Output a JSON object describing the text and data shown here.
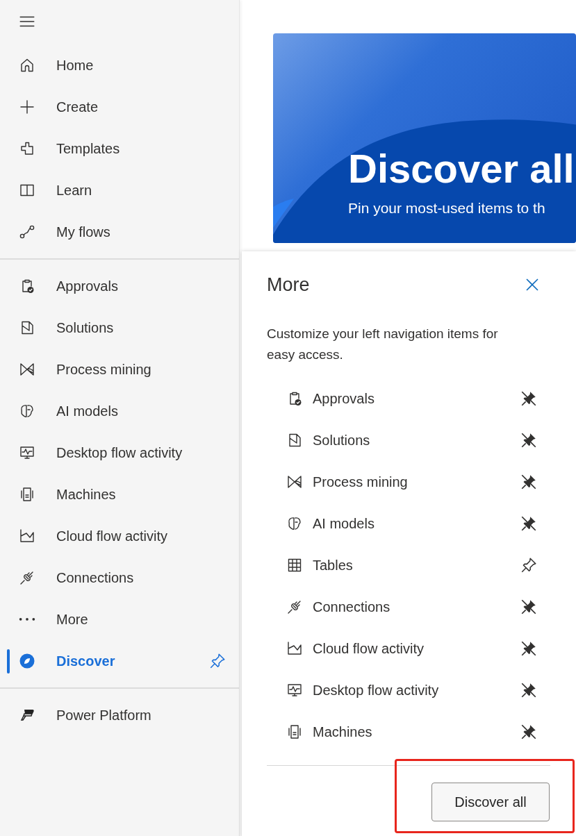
{
  "sidebar": {
    "sections": [
      {
        "items": [
          {
            "label": "Home",
            "selected": false
          },
          {
            "label": "Create",
            "selected": false
          },
          {
            "label": "Templates",
            "selected": false
          },
          {
            "label": "Learn",
            "selected": false
          },
          {
            "label": "My flows",
            "selected": false
          }
        ]
      },
      {
        "items": [
          {
            "label": "Approvals",
            "selected": false
          },
          {
            "label": "Solutions",
            "selected": false
          },
          {
            "label": "Process mining",
            "selected": false
          },
          {
            "label": "AI models",
            "selected": false
          },
          {
            "label": "Desktop flow activity",
            "selected": false
          },
          {
            "label": "Machines",
            "selected": false
          },
          {
            "label": "Cloud flow activity",
            "selected": false
          },
          {
            "label": "Connections",
            "selected": false
          },
          {
            "label": "More",
            "selected": false
          },
          {
            "label": "Discover",
            "selected": true
          }
        ]
      }
    ],
    "footer_item": {
      "label": "Power Platform"
    }
  },
  "banner": {
    "title": "Discover all",
    "subtitle": "Pin your most-used items to th"
  },
  "more_panel": {
    "title": "More",
    "description": "Customize your left navigation items for easy access.",
    "items": [
      {
        "label": "Approvals",
        "pinned": true
      },
      {
        "label": "Solutions",
        "pinned": true
      },
      {
        "label": "Process mining",
        "pinned": true
      },
      {
        "label": "AI models",
        "pinned": true
      },
      {
        "label": "Tables",
        "pinned": false
      },
      {
        "label": "Connections",
        "pinned": true
      },
      {
        "label": "Cloud flow activity",
        "pinned": true
      },
      {
        "label": "Desktop flow activity",
        "pinned": true
      },
      {
        "label": "Machines",
        "pinned": true
      }
    ],
    "button": "Discover all"
  }
}
